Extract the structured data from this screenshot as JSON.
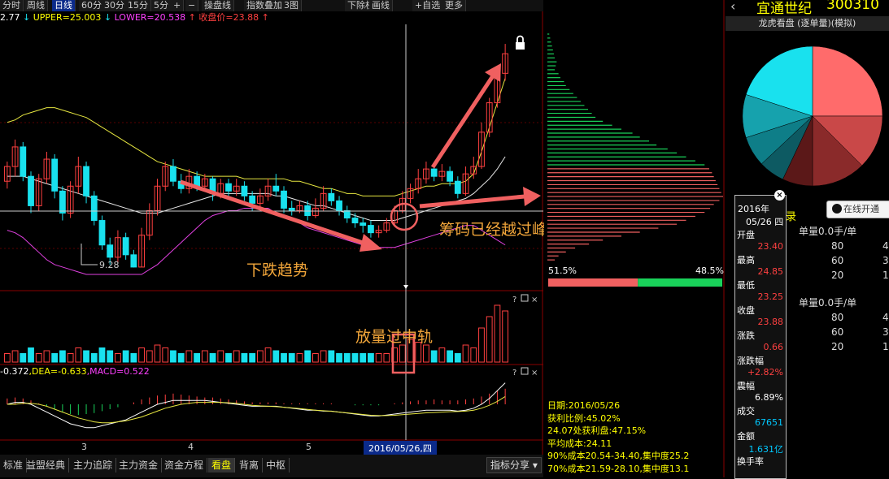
{
  "toolbar": {
    "buttons": [
      "分时",
      "周线",
      "日线",
      "60分",
      "30分",
      "15分",
      "5分",
      "+",
      "−",
      "操盘线",
      "指数叠加",
      "3图",
      "下除权",
      "画线",
      "+自选",
      "更多"
    ],
    "active": "日线"
  },
  "indicator_line": {
    "prefix": "2.77",
    "upper": "UPPER=25.003",
    "lower": "LOWER=20.538",
    "close": "收盘价=23.88"
  },
  "macd_line": {
    "dif": "-0.372",
    "dea": ",DEA=-0.633",
    "macd": ",MACD=0.522"
  },
  "stock": {
    "name": "宜通世纪",
    "code": "300310"
  },
  "panel_title": "龙虎看盘 (逐单量)(模拟)",
  "online_btn": "在线开通",
  "record_label": "录",
  "annotations": {
    "downtrend": "下跌趋势",
    "breakout": "筹码已经越过峰值",
    "volume": "放量过中轨",
    "low_price": "9.28"
  },
  "date_axis": {
    "ticks": [
      "3",
      "4",
      "5"
    ],
    "cursor": "2016/05/26,四"
  },
  "tabs": [
    "标准",
    "益盟经典",
    "主力追踪",
    "主力资金",
    "资金方程",
    "看盘",
    "背离",
    "中枢"
  ],
  "active_tab": "看盘",
  "index_share": "指标分享",
  "chip": {
    "left_pct": "51.5%",
    "right_pct": "48.5%",
    "lines": [
      "日期:2016/05/26",
      "获利比例:45.02%",
      "24.07处获利盘:47.15%",
      "平均成本:24.11",
      "90%成本20.54-34.40,集中度25.2",
      "70%成本21.59-28.10,集中度13.1"
    ]
  },
  "tooltip": {
    "year": "2016年",
    "date": "05/26 四",
    "items": [
      {
        "label": "开盘",
        "value": "23.40",
        "color": "#ff4040"
      },
      {
        "label": "最高",
        "value": "24.85",
        "color": "#ff4040"
      },
      {
        "label": "最低",
        "value": "23.25",
        "color": "#ff4040"
      },
      {
        "label": "收盘",
        "value": "23.88",
        "color": "#ff4040"
      },
      {
        "label": "涨跌",
        "value": "0.66",
        "color": "#ff4040"
      },
      {
        "label": "涨跌幅",
        "value": "+2.82%",
        "color": "#ff4040"
      },
      {
        "label": "震幅",
        "value": "6.89%",
        "color": "#ffffff"
      },
      {
        "label": "成交",
        "value": "67651",
        "color": "#00c8ff"
      },
      {
        "label": "金额",
        "value": "1.631亿",
        "color": "#00c8ff"
      },
      {
        "label": "换手率",
        "value": "",
        "color": "#ffffff"
      }
    ]
  },
  "orders": {
    "title1": "单量0.0手/单",
    "rows1": [
      [
        "80",
        "4"
      ],
      [
        "60",
        "3"
      ],
      [
        "20",
        "1"
      ]
    ],
    "title2": "单量0.0手/单",
    "rows2": [
      [
        "80",
        "4"
      ],
      [
        "60",
        "3"
      ],
      [
        "20",
        "1"
      ]
    ]
  },
  "pie": {
    "slices": [
      {
        "value": 25,
        "color": "#ff6b6b"
      },
      {
        "value": 12.5,
        "color": "#c94848"
      },
      {
        "value": 12.5,
        "color": "#8a2a2a"
      },
      {
        "value": 7,
        "color": "#5b1818"
      },
      {
        "value": 6,
        "color": "#0d5a62"
      },
      {
        "value": 7,
        "color": "#0e7e88"
      },
      {
        "value": 10,
        "color": "#16a2ad"
      },
      {
        "value": 20,
        "color": "#19e1ee"
      }
    ]
  },
  "chart_data": {
    "type": "candlestick",
    "candles": [
      [
        22.8,
        23.4,
        22.5,
        23.6
      ],
      [
        23.4,
        24.2,
        23.0,
        24.5
      ],
      [
        24.2,
        23.0,
        22.8,
        24.4
      ],
      [
        23.0,
        21.8,
        21.5,
        23.2
      ],
      [
        21.8,
        22.9,
        21.6,
        23.1
      ],
      [
        22.9,
        23.7,
        22.7,
        24.0
      ],
      [
        23.7,
        22.4,
        22.1,
        23.9
      ],
      [
        22.4,
        21.5,
        21.2,
        22.6
      ],
      [
        21.5,
        22.6,
        21.3,
        22.8
      ],
      [
        22.6,
        23.4,
        22.3,
        23.8
      ],
      [
        23.4,
        22.2,
        21.9,
        23.6
      ],
      [
        22.2,
        21.2,
        21.0,
        22.4
      ],
      [
        21.2,
        20.2,
        20.0,
        21.4
      ],
      [
        20.2,
        19.7,
        19.4,
        20.5
      ],
      [
        19.7,
        20.5,
        19.5,
        20.8
      ],
      [
        20.5,
        19.8,
        19.6,
        20.7
      ],
      [
        19.8,
        19.3,
        19.28,
        20.0
      ],
      [
        19.3,
        20.6,
        19.3,
        20.9
      ],
      [
        20.6,
        21.6,
        20.4,
        21.9
      ],
      [
        21.6,
        22.6,
        21.4,
        22.9
      ],
      [
        22.6,
        23.4,
        22.4,
        23.6
      ],
      [
        23.4,
        22.8,
        22.6,
        23.7
      ],
      [
        22.8,
        22.5,
        22.3,
        23.1
      ],
      [
        22.5,
        23.0,
        22.3,
        23.3
      ],
      [
        23.0,
        22.6,
        22.4,
        23.2
      ],
      [
        22.6,
        22.9,
        22.4,
        23.1
      ],
      [
        22.9,
        22.3,
        22.0,
        23.0
      ],
      [
        22.3,
        22.7,
        22.1,
        22.9
      ],
      [
        22.7,
        22.4,
        22.2,
        22.9
      ],
      [
        22.4,
        22.6,
        22.2,
        22.9
      ],
      [
        22.6,
        22.2,
        22.0,
        22.8
      ],
      [
        22.2,
        21.9,
        21.6,
        22.4
      ],
      [
        21.9,
        22.2,
        21.7,
        22.5
      ],
      [
        22.2,
        22.6,
        22.0,
        22.9
      ],
      [
        22.6,
        22.4,
        22.2,
        23.1
      ],
      [
        22.4,
        21.7,
        21.5,
        22.6
      ],
      [
        21.7,
        21.6,
        21.4,
        22.0
      ],
      [
        21.6,
        21.8,
        21.5,
        22.0
      ],
      [
        21.8,
        21.4,
        21.2,
        22.0
      ],
      [
        21.4,
        21.7,
        21.3,
        22.1
      ],
      [
        21.7,
        22.3,
        21.6,
        22.6
      ],
      [
        22.3,
        22.0,
        21.8,
        22.5
      ],
      [
        22.0,
        21.6,
        21.4,
        22.2
      ],
      [
        21.6,
        21.3,
        21.1,
        21.8
      ],
      [
        21.3,
        21.1,
        20.9,
        21.5
      ],
      [
        21.1,
        21.0,
        20.7,
        21.3
      ],
      [
        21.0,
        20.7,
        20.5,
        21.2
      ],
      [
        20.7,
        20.8,
        20.5,
        21.0
      ],
      [
        20.8,
        21.1,
        20.7,
        21.3
      ],
      [
        21.1,
        21.6,
        21.0,
        21.8
      ],
      [
        21.6,
        22.1,
        21.5,
        22.4
      ],
      [
        22.1,
        22.5,
        21.9,
        22.7
      ],
      [
        22.5,
        22.9,
        22.3,
        23.3
      ],
      [
        22.9,
        23.3,
        22.7,
        23.6
      ],
      [
        23.3,
        23.0,
        22.8,
        23.5
      ],
      [
        23.0,
        23.2,
        22.8,
        23.5
      ],
      [
        23.2,
        22.8,
        22.6,
        23.4
      ],
      [
        22.8,
        22.3,
        22.1,
        23.0
      ],
      [
        22.3,
        23.1,
        22.2,
        23.4
      ],
      [
        23.1,
        23.4,
        22.9,
        23.8
      ],
      [
        23.4,
        24.8,
        23.3,
        25.2
      ],
      [
        24.8,
        26.0,
        24.6,
        26.2
      ],
      [
        26.0,
        27.2,
        25.8,
        27.5
      ],
      [
        27.2,
        28.0,
        26.9,
        28.4
      ]
    ],
    "volumes": [
      3,
      4,
      3,
      5,
      3,
      4,
      3,
      4,
      3,
      5,
      4,
      3,
      5,
      4,
      3,
      4,
      3,
      5,
      4,
      6,
      5,
      4,
      3,
      4,
      3,
      4,
      3,
      4,
      3,
      4,
      3,
      3,
      4,
      5,
      4,
      3,
      3,
      3,
      4,
      3,
      4,
      4,
      3,
      3,
      3,
      3,
      3,
      3,
      3,
      5,
      6,
      8,
      7,
      6,
      4,
      5,
      4,
      3,
      6,
      5,
      12,
      16,
      20,
      18
    ],
    "boll_upper": [
      25.2,
      25.3,
      25.5,
      25.6,
      25.7,
      25.8,
      25.8,
      25.7,
      25.6,
      25.5,
      25.4,
      25.2,
      25.0,
      24.8,
      24.6,
      24.4,
      24.2,
      24.0,
      23.8,
      23.6,
      23.5,
      23.4,
      23.3,
      23.2,
      23.1,
      23.0,
      23.0,
      23.0,
      23.0,
      23.0,
      22.9,
      22.9,
      22.9,
      22.9,
      22.9,
      22.9,
      22.8,
      22.8,
      22.7,
      22.6,
      22.5,
      22.5,
      22.4,
      22.3,
      22.3,
      22.2,
      22.2,
      22.2,
      22.2,
      22.2,
      22.3,
      22.4,
      22.5,
      22.6,
      22.6,
      22.7,
      22.7,
      22.7,
      22.8,
      23.1,
      24.0,
      25.0,
      26.0,
      27.0
    ],
    "boll_mid": [
      23.0,
      23.0,
      23.0,
      22.9,
      22.8,
      22.7,
      22.6,
      22.5,
      22.4,
      22.3,
      22.2,
      22.1,
      22.0,
      21.9,
      21.8,
      21.7,
      21.6,
      21.5,
      21.5,
      21.5,
      21.6,
      21.7,
      21.8,
      21.9,
      22.0,
      22.1,
      22.2,
      22.3,
      22.3,
      22.3,
      22.3,
      22.3,
      22.3,
      22.3,
      22.2,
      22.2,
      22.1,
      22.0,
      21.9,
      21.8,
      21.8,
      21.7,
      21.6,
      21.5,
      21.4,
      21.3,
      21.2,
      21.2,
      21.2,
      21.2,
      21.3,
      21.4,
      21.5,
      21.6,
      21.7,
      21.8,
      21.9,
      22.0,
      22.1,
      22.3,
      22.6,
      22.9,
      23.3,
      23.8
    ],
    "boll_lower": [
      20.8,
      20.7,
      20.5,
      20.2,
      19.9,
      19.6,
      19.4,
      19.3,
      19.2,
      19.1,
      19.0,
      19.0,
      19.0,
      19.0,
      19.0,
      19.0,
      19.0,
      19.0,
      19.2,
      19.4,
      19.7,
      20.0,
      20.3,
      20.6,
      20.9,
      21.2,
      21.4,
      21.5,
      21.6,
      21.6,
      21.7,
      21.7,
      21.7,
      21.7,
      21.5,
      21.4,
      21.3,
      21.1,
      20.9,
      20.8,
      20.7,
      20.6,
      20.5,
      20.4,
      20.3,
      20.2,
      20.1,
      20.1,
      20.1,
      20.1,
      20.2,
      20.3,
      20.4,
      20.5,
      20.6,
      20.7,
      20.8,
      20.9,
      21.0,
      21.0,
      20.8,
      20.6,
      20.4,
      20.2
    ],
    "macd_hist": [
      0.3,
      0.35,
      0.3,
      0.2,
      0.05,
      -0.1,
      -0.25,
      -0.4,
      -0.5,
      -0.55,
      -0.5,
      -0.45,
      -0.35,
      -0.25,
      -0.15,
      0.0,
      0.1,
      0.25,
      0.35,
      0.45,
      0.5,
      0.55,
      0.5,
      0.45,
      0.4,
      0.35,
      0.35,
      0.3,
      0.25,
      0.2,
      0.15,
      0.1,
      0.1,
      0.1,
      0.1,
      0.05,
      0.05,
      0.05,
      0.05,
      0.05,
      0.05,
      0.05,
      0.0,
      0.0,
      -0.05,
      -0.05,
      -0.05,
      -0.05,
      0.0,
      0.05,
      0.1,
      0.15,
      0.2,
      0.2,
      0.25,
      0.2,
      0.2,
      0.2,
      0.25,
      0.3,
      0.4,
      0.55,
      0.7,
      0.8
    ],
    "dif": [
      0.0,
      0.1,
      0.1,
      0.0,
      -0.2,
      -0.4,
      -0.6,
      -0.8,
      -1.0,
      -1.1,
      -1.2,
      -1.2,
      -1.1,
      -1.0,
      -0.9,
      -0.8,
      -0.6,
      -0.4,
      -0.2,
      0.0,
      0.1,
      0.2,
      0.2,
      0.2,
      0.2,
      0.2,
      0.15,
      0.1,
      0.05,
      0.0,
      -0.05,
      -0.1,
      -0.1,
      -0.1,
      -0.1,
      -0.15,
      -0.2,
      -0.25,
      -0.3,
      -0.3,
      -0.35,
      -0.35,
      -0.4,
      -0.45,
      -0.5,
      -0.55,
      -0.6,
      -0.6,
      -0.55,
      -0.5,
      -0.45,
      -0.4,
      -0.35,
      -0.3,
      -0.3,
      -0.3,
      -0.3,
      -0.35,
      -0.3,
      -0.2,
      0.0,
      0.3,
      0.7,
      1.1
    ],
    "dea": [
      0.0,
      0.0,
      0.05,
      0.05,
      0.0,
      -0.1,
      -0.25,
      -0.4,
      -0.55,
      -0.7,
      -0.8,
      -0.9,
      -0.95,
      -0.95,
      -0.9,
      -0.85,
      -0.75,
      -0.65,
      -0.5,
      -0.35,
      -0.2,
      -0.1,
      0.0,
      0.05,
      0.1,
      0.1,
      0.1,
      0.1,
      0.08,
      0.05,
      0.0,
      -0.05,
      -0.08,
      -0.1,
      -0.12,
      -0.15,
      -0.18,
      -0.22,
      -0.26,
      -0.3,
      -0.33,
      -0.36,
      -0.4,
      -0.44,
      -0.48,
      -0.52,
      -0.56,
      -0.58,
      -0.58,
      -0.56,
      -0.53,
      -0.5,
      -0.47,
      -0.44,
      -0.42,
      -0.4,
      -0.38,
      -0.37,
      -0.35,
      -0.3,
      -0.2,
      -0.05,
      0.15,
      0.4
    ],
    "price_range": [
      19.0,
      28.8
    ],
    "chip_profile": [
      2,
      3,
      4,
      5,
      6,
      7,
      8,
      10,
      9,
      8,
      12,
      14,
      18,
      20,
      24,
      28,
      32,
      36,
      40,
      44,
      48,
      52,
      60,
      70,
      80,
      92,
      100,
      110,
      118,
      130,
      140,
      150,
      160,
      170,
      175,
      178,
      180,
      182,
      184,
      186,
      188,
      190,
      186,
      180,
      176,
      170,
      160,
      150,
      140,
      120,
      100,
      80,
      60,
      45,
      30,
      20,
      12,
      8
    ],
    "chip_split": 0.515
  }
}
